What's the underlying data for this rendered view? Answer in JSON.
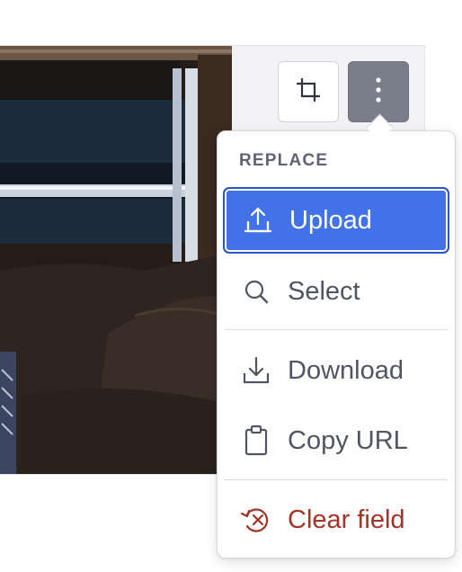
{
  "toolbar": {
    "crop_icon": "crop-icon",
    "more_icon": "more-vertical-icon"
  },
  "image": {
    "icon": "photo-image"
  },
  "menu": {
    "heading": "REPLACE",
    "items": [
      {
        "label": "Upload",
        "icon": "upload-icon",
        "active": true
      },
      {
        "label": "Select",
        "icon": "search-icon",
        "active": false
      },
      {
        "label": "Download",
        "icon": "download-icon",
        "active": false
      },
      {
        "label": "Copy URL",
        "icon": "clipboard-icon",
        "active": false
      },
      {
        "label": "Clear field",
        "icon": "clear-icon",
        "active": false,
        "tone": "danger"
      }
    ]
  },
  "colors": {
    "accent": "#4372e8",
    "danger": "#a33227",
    "text": "#4f5563",
    "more_button": "#7a7e8a"
  }
}
